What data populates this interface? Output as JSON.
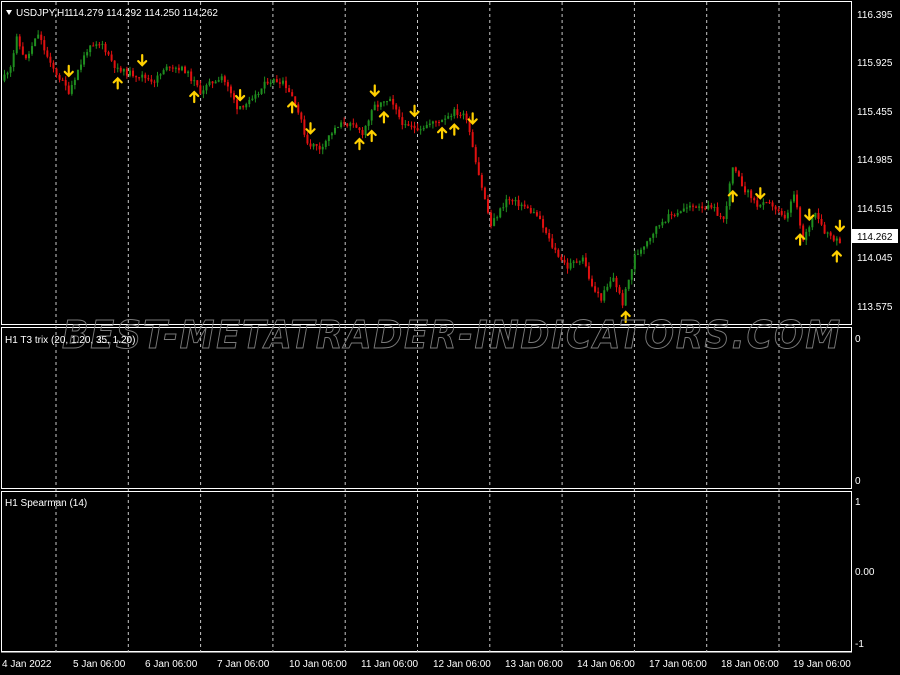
{
  "symbol_header": {
    "collapse_icon": "triangle-down-icon",
    "symbol": "USDJPY,H1",
    "ohlc": "114.279 114.292 114.250 114.262"
  },
  "watermark": "BEST-METATRADER-INDICATORS.COM",
  "price_axis": [
    "116.395",
    "115.925",
    "115.455",
    "114.985",
    "114.515",
    "114.045",
    "113.575"
  ],
  "current_price": "114.262",
  "indicator1": {
    "title": "H1 T3 trix (20, 1.20, 35, 1.20)",
    "axis": [
      "0",
      "0"
    ]
  },
  "indicator2": {
    "title": "H1 Spearman (14)",
    "axis": [
      "1",
      "0.00",
      "-1"
    ]
  },
  "time_axis": [
    "4 Jan 2022",
    "5 Jan 06:00",
    "6 Jan 06:00",
    "7 Jan 06:00",
    "10 Jan 06:00",
    "11 Jan 06:00",
    "12 Jan 06:00",
    "13 Jan 06:00",
    "14 Jan 06:00",
    "17 Jan 06:00",
    "18 Jan 06:00",
    "19 Jan 06:00"
  ],
  "colors": {
    "bull": "#1f8f1f",
    "bear": "#e01010",
    "arrow": "#ffd000",
    "grid": "#c8c8c8",
    "border": "#ffffff"
  },
  "chart_data": {
    "type": "candlestick",
    "y_range": [
      113.45,
      116.55
    ],
    "key_points": [
      {
        "x": 0,
        "p": 115.8
      },
      {
        "x": 3,
        "p": 115.95
      },
      {
        "x": 5,
        "p": 116.2
      },
      {
        "x": 8,
        "p": 116.0
      },
      {
        "x": 12,
        "p": 116.25
      },
      {
        "x": 16,
        "p": 115.95
      },
      {
        "x": 22,
        "p": 115.7
      },
      {
        "x": 28,
        "p": 116.1
      },
      {
        "x": 33,
        "p": 116.15
      },
      {
        "x": 38,
        "p": 115.9
      },
      {
        "x": 45,
        "p": 115.85
      },
      {
        "x": 50,
        "p": 115.8
      },
      {
        "x": 55,
        "p": 115.95
      },
      {
        "x": 60,
        "p": 115.9
      },
      {
        "x": 65,
        "p": 115.7
      },
      {
        "x": 72,
        "p": 115.85
      },
      {
        "x": 77,
        "p": 115.55
      },
      {
        "x": 82,
        "p": 115.6
      },
      {
        "x": 87,
        "p": 115.8
      },
      {
        "x": 92,
        "p": 115.8
      },
      {
        "x": 96,
        "p": 115.6
      },
      {
        "x": 100,
        "p": 115.2
      },
      {
        "x": 104,
        "p": 115.15
      },
      {
        "x": 108,
        "p": 115.3
      },
      {
        "x": 112,
        "p": 115.4
      },
      {
        "x": 118,
        "p": 115.3
      },
      {
        "x": 122,
        "p": 115.55
      },
      {
        "x": 127,
        "p": 115.6
      },
      {
        "x": 132,
        "p": 115.35
      },
      {
        "x": 137,
        "p": 115.35
      },
      {
        "x": 142,
        "p": 115.4
      },
      {
        "x": 148,
        "p": 115.5
      },
      {
        "x": 152,
        "p": 115.45
      },
      {
        "x": 156,
        "p": 114.9
      },
      {
        "x": 160,
        "p": 114.4
      },
      {
        "x": 165,
        "p": 114.65
      },
      {
        "x": 170,
        "p": 114.6
      },
      {
        "x": 175,
        "p": 114.5
      },
      {
        "x": 180,
        "p": 114.2
      },
      {
        "x": 185,
        "p": 114.0
      },
      {
        "x": 190,
        "p": 114.1
      },
      {
        "x": 193,
        "p": 113.8
      },
      {
        "x": 196,
        "p": 113.7
      },
      {
        "x": 200,
        "p": 113.9
      },
      {
        "x": 203,
        "p": 113.65
      },
      {
        "x": 207,
        "p": 114.1
      },
      {
        "x": 212,
        "p": 114.3
      },
      {
        "x": 216,
        "p": 114.45
      },
      {
        "x": 222,
        "p": 114.55
      },
      {
        "x": 228,
        "p": 114.6
      },
      {
        "x": 233,
        "p": 114.55
      },
      {
        "x": 236,
        "p": 114.45
      },
      {
        "x": 239,
        "p": 114.95
      },
      {
        "x": 243,
        "p": 114.75
      },
      {
        "x": 247,
        "p": 114.6
      },
      {
        "x": 252,
        "p": 114.6
      },
      {
        "x": 256,
        "p": 114.45
      },
      {
        "x": 259,
        "p": 114.7
      },
      {
        "x": 262,
        "p": 114.25
      },
      {
        "x": 266,
        "p": 114.55
      },
      {
        "x": 269,
        "p": 114.35
      },
      {
        "x": 273,
        "p": 114.26
      }
    ],
    "bars": 274,
    "buy_arrows": [
      37,
      62,
      94,
      116,
      120,
      124,
      143,
      147,
      203,
      238,
      260,
      272
    ],
    "sell_arrows": [
      21,
      45,
      77,
      100,
      121,
      134,
      153,
      247,
      263,
      274
    ]
  }
}
